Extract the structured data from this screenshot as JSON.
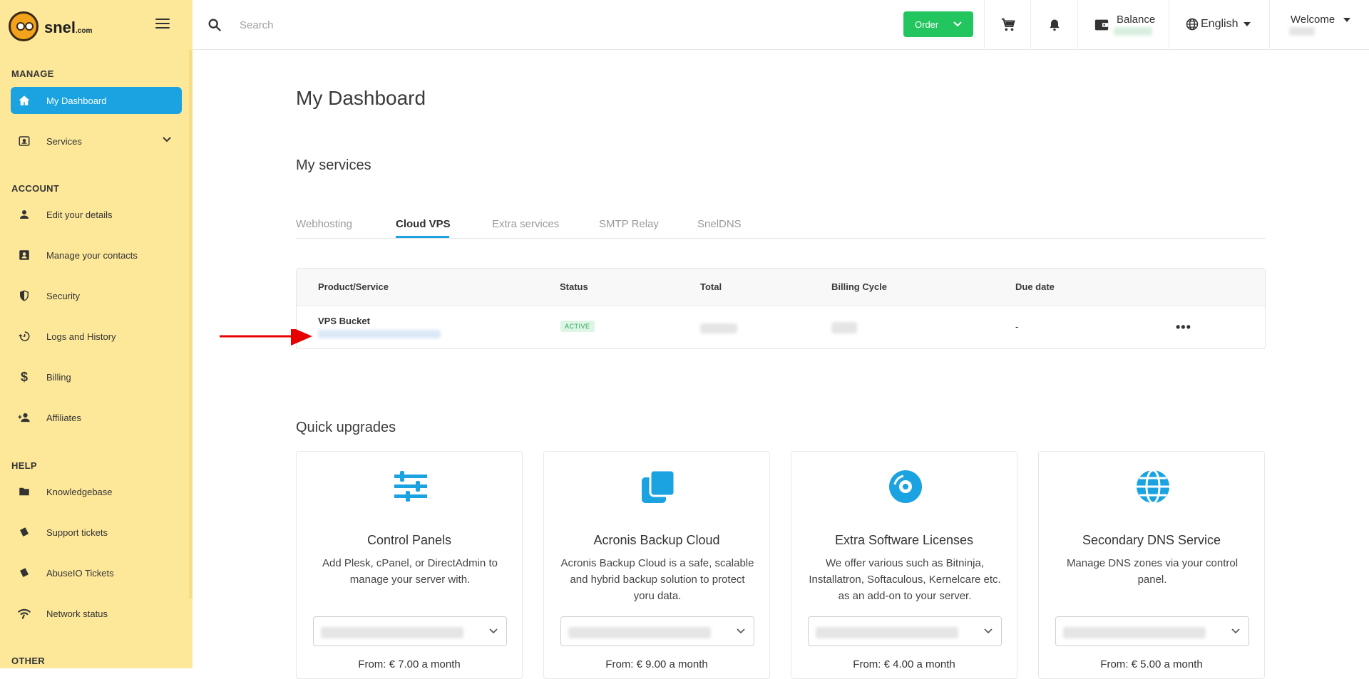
{
  "brand": {
    "name": "snel",
    "suffix": ".com"
  },
  "sidebar": {
    "sections": {
      "manage": "MANAGE",
      "account": "ACCOUNT",
      "help": "HELP",
      "other": "OTHER"
    },
    "items": [
      {
        "label": "My Dashboard",
        "icon": "home-icon",
        "active": true
      },
      {
        "label": "Services",
        "icon": "services-icon"
      },
      {
        "label": "Edit your details",
        "icon": "user-icon"
      },
      {
        "label": "Manage your contacts",
        "icon": "contacts-icon"
      },
      {
        "label": "Security",
        "icon": "shield-icon"
      },
      {
        "label": "Logs and History",
        "icon": "history-icon"
      },
      {
        "label": "Billing",
        "icon": "dollar-icon"
      },
      {
        "label": "Affiliates",
        "icon": "affiliates-icon"
      },
      {
        "label": "Knowledgebase",
        "icon": "folder-icon"
      },
      {
        "label": "Support tickets",
        "icon": "ticket-icon"
      },
      {
        "label": "AbuseIO Tickets",
        "icon": "ticket-icon"
      },
      {
        "label": "Network status",
        "icon": "signal-icon"
      }
    ]
  },
  "topbar": {
    "search_placeholder": "Search",
    "order_label": "Order",
    "balance_label": "Balance",
    "language": "English",
    "welcome": "Welcome"
  },
  "main": {
    "title": "My Dashboard",
    "services_title": "My services",
    "tabs": [
      "Webhosting",
      "Cloud VPS",
      "Extra services",
      "SMTP Relay",
      "SnelDNS"
    ],
    "active_tab": "Cloud VPS",
    "table": {
      "headers": [
        "Product/Service",
        "Status",
        "Total",
        "Billing Cycle",
        "Due date"
      ],
      "rows": [
        {
          "product": "VPS Bucket",
          "status": "ACTIVE",
          "due_date": "-"
        }
      ]
    },
    "upgrades_title": "Quick upgrades",
    "cards": [
      {
        "title": "Control Panels",
        "desc": "Add Plesk, cPanel, or DirectAdmin to manage your server with.",
        "price": "From: € 7.00 a month",
        "icon": "sliders-icon"
      },
      {
        "title": "Acronis Backup Cloud",
        "desc": "Acronis Backup Cloud is a safe, scalable and hybrid backup solution to protect yoru data.",
        "price": "From: € 9.00 a month",
        "icon": "copy-icon"
      },
      {
        "title": "Extra Software Licenses",
        "desc": "We offer various such as Bitninja, Installatron, Softaculous, Kernelcare etc. as an add-on to your server.",
        "price": "From: € 4.00 a month",
        "icon": "disc-icon"
      },
      {
        "title": "Secondary DNS Service",
        "desc": "Manage DNS zones via your control panel.",
        "price": "From: € 5.00 a month",
        "icon": "globe-icon"
      }
    ]
  },
  "colors": {
    "sidebar_bg": "#fde89a",
    "accent": "#1aa3e0",
    "order_green": "#22c55e",
    "arrow_red": "#e60000"
  }
}
